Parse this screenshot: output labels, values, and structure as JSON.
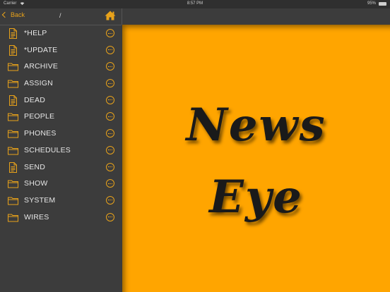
{
  "status_bar": {
    "carrier": "Carrier",
    "time": "8:57 PM",
    "battery": "95%"
  },
  "nav": {
    "back_label": "Back",
    "title": "/"
  },
  "items": [
    {
      "label": "*HELP",
      "icon": "document-icon"
    },
    {
      "label": "*UPDATE",
      "icon": "document-icon"
    },
    {
      "label": "ARCHIVE",
      "icon": "folder-icon"
    },
    {
      "label": "ASSIGN",
      "icon": "folder-icon"
    },
    {
      "label": "DEAD",
      "icon": "document-icon"
    },
    {
      "label": "PEOPLE",
      "icon": "folder-icon"
    },
    {
      "label": "PHONES",
      "icon": "folder-icon"
    },
    {
      "label": "SCHEDULES",
      "icon": "folder-icon"
    },
    {
      "label": "SEND",
      "icon": "document-icon"
    },
    {
      "label": "SHOW",
      "icon": "folder-icon"
    },
    {
      "label": "SYSTEM",
      "icon": "folder-icon"
    },
    {
      "label": "WIRES",
      "icon": "folder-icon"
    }
  ],
  "logo": {
    "line1": "News",
    "line2": "Eye"
  },
  "colors": {
    "accent": "#e8a21a",
    "main_background": "#ffa500",
    "sidebar_background": "#3c3c3c"
  }
}
